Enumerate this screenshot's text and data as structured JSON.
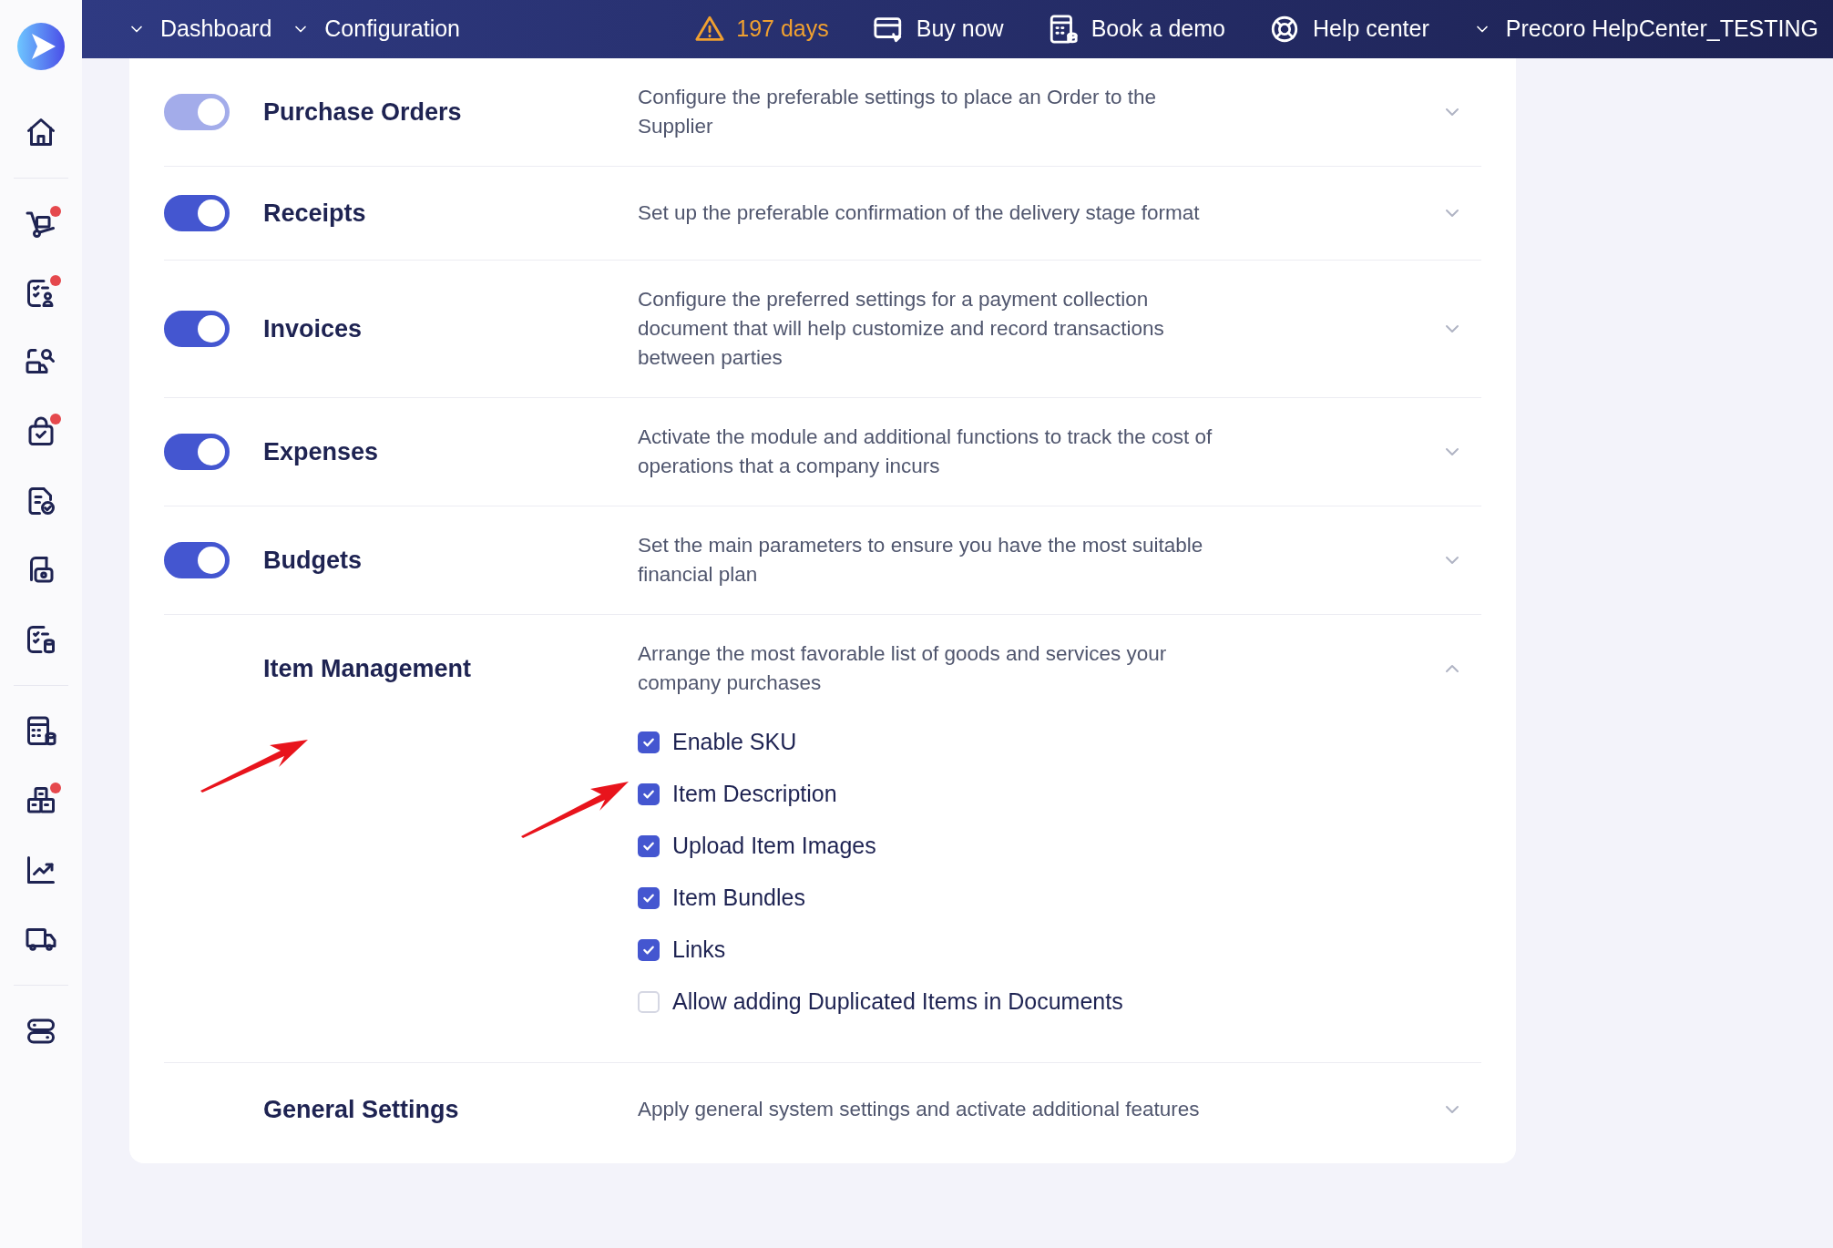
{
  "top_bar": {
    "menus": [
      {
        "label": "Dashboard"
      },
      {
        "label": "Configuration"
      }
    ],
    "trial": {
      "text": "197 days"
    },
    "links": [
      {
        "label": "Buy now"
      },
      {
        "label": "Book a demo"
      },
      {
        "label": "Help center"
      }
    ],
    "account": {
      "label": "Precoro HelpCenter_TESTING"
    }
  },
  "sidebar": {
    "groups": [
      [
        {
          "badge": false
        }
      ],
      [
        {
          "badge": true
        },
        {
          "badge": true
        },
        {
          "badge": false
        },
        {
          "badge": true
        },
        {
          "badge": false
        },
        {
          "badge": false
        },
        {
          "badge": false
        }
      ],
      [
        {
          "badge": false
        },
        {
          "badge": true
        },
        {
          "badge": false
        },
        {
          "badge": false
        }
      ],
      [
        {
          "badge": false
        }
      ]
    ]
  },
  "modules": [
    {
      "title": "Purchase Orders",
      "description": "Configure the preferable settings to place an Order to the Supplier",
      "toggle": {
        "on": true,
        "disabled": true
      },
      "expanded": false
    },
    {
      "title": "Receipts",
      "description": "Set up the preferable confirmation of the delivery stage format",
      "toggle": {
        "on": true,
        "disabled": false
      },
      "expanded": false
    },
    {
      "title": "Invoices",
      "description": "Configure the preferred settings for a payment collection document that will help customize and record transactions between parties",
      "toggle": {
        "on": true,
        "disabled": false
      },
      "expanded": false
    },
    {
      "title": "Expenses",
      "description": "Activate the module and additional functions to track the cost of operations that a company incurs",
      "toggle": {
        "on": true,
        "disabled": false
      },
      "expanded": false
    },
    {
      "title": "Budgets",
      "description": "Set the main parameters to ensure you have the most suitable financial plan",
      "toggle": {
        "on": true,
        "disabled": false
      },
      "expanded": false
    },
    {
      "title": "Item Management",
      "description": "Arrange the most favorable list of goods and services your company purchases",
      "expanded": true,
      "options": [
        {
          "label": "Enable SKU",
          "checked": true
        },
        {
          "label": "Item Description",
          "checked": true
        },
        {
          "label": "Upload Item Images",
          "checked": true
        },
        {
          "label": "Item Bundles",
          "checked": true
        },
        {
          "label": "Links",
          "checked": true
        },
        {
          "label": "Allow adding Duplicated Items in Documents",
          "checked": false
        }
      ]
    },
    {
      "title": "General Settings",
      "description": "Apply general system settings and activate additional features",
      "expanded": false
    }
  ]
}
